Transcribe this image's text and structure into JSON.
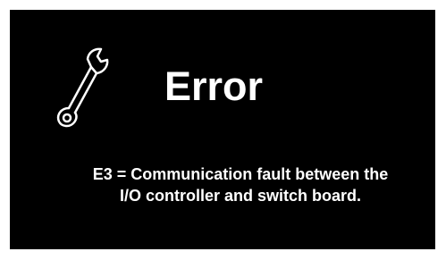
{
  "dialog": {
    "icon": "wrench-icon",
    "title": "Error",
    "message_line1": "E3 = Communication fault between the",
    "message_line2": "I/O controller and switch board."
  },
  "colors": {
    "background": "#000000",
    "text": "#ffffff",
    "frame": "#ffffff"
  }
}
